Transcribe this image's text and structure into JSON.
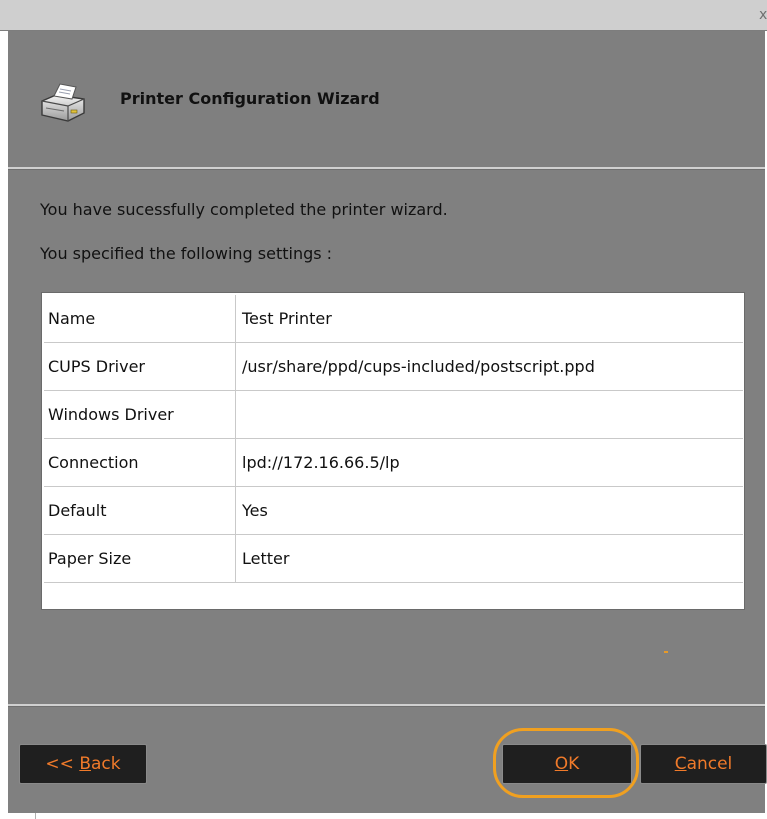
{
  "window": {
    "close_glyph": "x"
  },
  "header": {
    "title": "Printer Configuration Wizard",
    "icon": "printer-icon"
  },
  "body": {
    "completed_text": "You have sucessfully completed the printer wizard.",
    "settings_intro": "You specified the following settings :"
  },
  "settings": {
    "rows": [
      {
        "name": "Name",
        "value": "Test Printer"
      },
      {
        "name": "CUPS Driver",
        "value": "/usr/share/ppd/cups-included/postscript.ppd"
      },
      {
        "name": "Windows Driver",
        "value": ""
      },
      {
        "name": "Connection",
        "value": "lpd://172.16.66.5/lp"
      },
      {
        "name": "Default",
        "value": "Yes"
      },
      {
        "name": "Paper Size",
        "value": "Letter"
      }
    ]
  },
  "buttons": {
    "back_prefix": "<< ",
    "back_mnemonic": "B",
    "back_rest": "ack",
    "ok_mnemonic": "O",
    "ok_rest": "K",
    "cancel_mnemonic": "C",
    "cancel_rest": "ancel"
  },
  "colors": {
    "button_text": "#f07a2a",
    "focus_ring": "#f0a020",
    "dialog_bg": "#808080"
  }
}
